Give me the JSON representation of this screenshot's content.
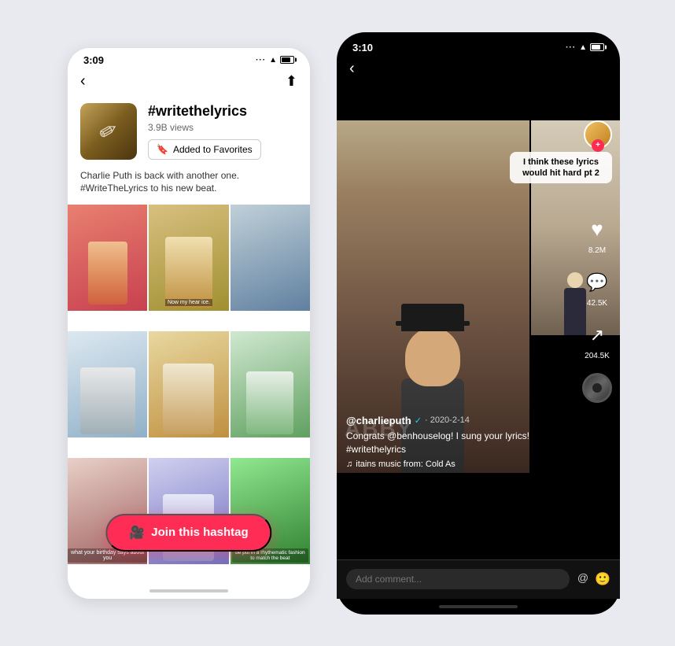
{
  "left_phone": {
    "status_time": "3:09",
    "hashtag_title": "#writethelyrics",
    "hashtag_views": "3.9B views",
    "favorites_label": "Added to Favorites",
    "description": "Charlie Puth is back with another one. #WriteTheLyrics to his new beat.",
    "join_button_label": "Join this hashtag",
    "video_cells": [
      {
        "id": 1,
        "color_class": "c1",
        "label": ""
      },
      {
        "id": 2,
        "color_class": "c2",
        "label": "Now my hear ice."
      },
      {
        "id": 3,
        "color_class": "c3",
        "label": ""
      },
      {
        "id": 4,
        "color_class": "c4",
        "label": ""
      },
      {
        "id": 5,
        "color_class": "c5",
        "label": ""
      },
      {
        "id": 6,
        "color_class": "c6",
        "label": ""
      },
      {
        "id": 7,
        "color_class": "c7",
        "label": "what your birthday says about you"
      },
      {
        "id": 8,
        "color_class": "c8",
        "label": ""
      },
      {
        "id": 9,
        "color_class": "c9",
        "label": "be put in a rhythematic fashion to match the beat"
      }
    ]
  },
  "right_phone": {
    "status_time": "3:10",
    "lyrics_overlay": "I think these lyrics would hit hard pt 2",
    "username": "@charlieputh",
    "verified": "✓",
    "post_date": "2020-2-14",
    "caption": "Congrats @benhouselog! I sung your lyrics! #writethelyrics",
    "music_text": "itains music from: Cold As",
    "like_count": "8.2M",
    "comment_count": "42.5K",
    "share_count": "204.5K",
    "comment_placeholder": "Add comment...",
    "comment_action_at": "@",
    "comment_action_emoji": "🙂"
  }
}
